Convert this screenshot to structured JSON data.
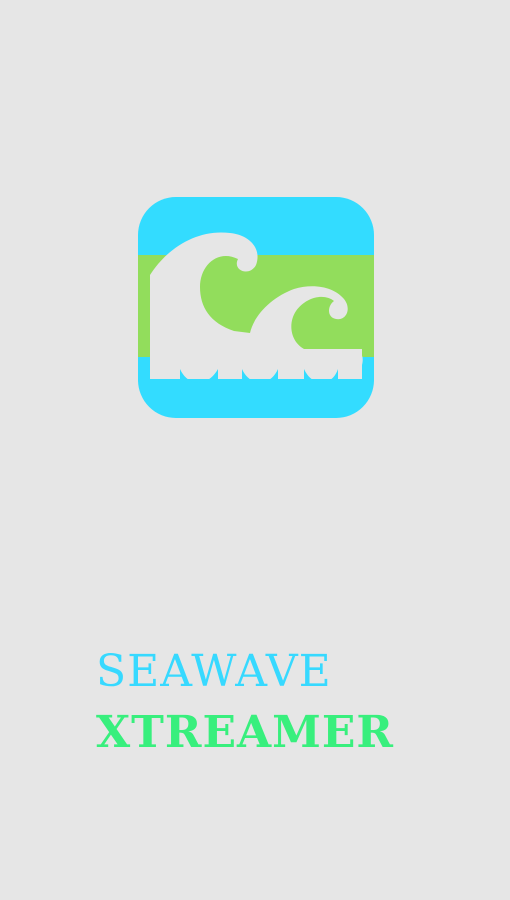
{
  "splash": {
    "logo_icon": "wave-icon",
    "brand_line_1": "SEAWAVE",
    "brand_line_2": "XTREAMER"
  },
  "colors": {
    "background": "#e6e6e6",
    "logo_blue": "#33dcff",
    "logo_green": "#92dd5c",
    "wave_white": "#e6e6e6",
    "brand_line_1": "#37d9ff",
    "brand_line_2": "#38ef7d"
  }
}
